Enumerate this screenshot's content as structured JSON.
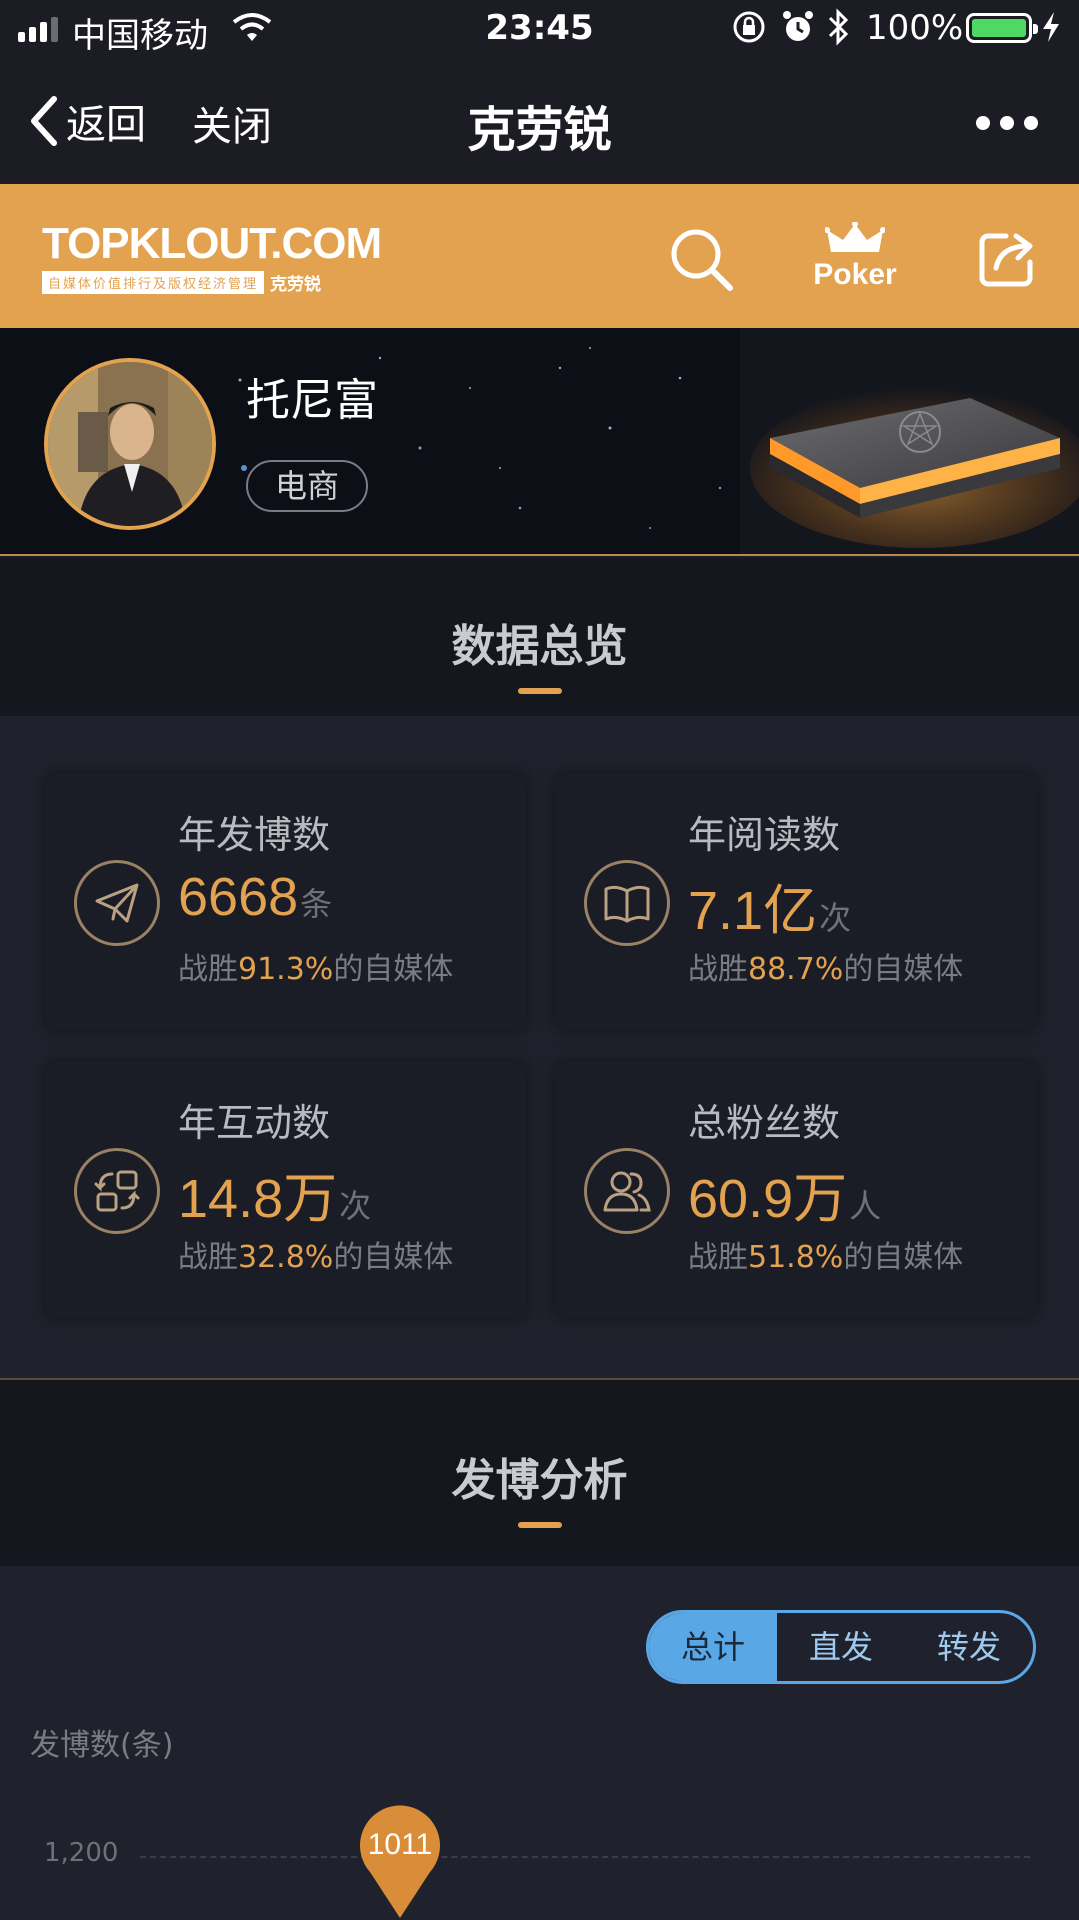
{
  "status_bar": {
    "carrier": "中国移动",
    "time": "23:45",
    "battery": "100%"
  },
  "nav": {
    "back_label": "返回",
    "close_label": "关闭",
    "title": "克劳锐"
  },
  "brand": {
    "logo": "TOPKLOUT.COM",
    "logo_tagline": "自媒体价值排行及版权经济管理",
    "logo_name": "克劳锐",
    "poker_label": "Poker"
  },
  "profile": {
    "name": "托尼富",
    "tag": "电商"
  },
  "overview": {
    "title": "数据总览",
    "cards": [
      {
        "label": "年发博数",
        "value": "6668",
        "unit": "条",
        "prefix": "战胜",
        "pct": "91.3%",
        "suffix": "的自媒体",
        "icon": "send-icon"
      },
      {
        "label": "年阅读数",
        "value": "7.1亿",
        "unit": "次",
        "prefix": "战胜",
        "pct": "88.7%",
        "suffix": "的自媒体",
        "icon": "book-icon"
      },
      {
        "label": "年互动数",
        "value": "14.8万",
        "unit": "次",
        "prefix": "战胜",
        "pct": "32.8%",
        "suffix": "的自媒体",
        "icon": "interaction-icon"
      },
      {
        "label": "总粉丝数",
        "value": "60.9万",
        "unit": "人",
        "prefix": "战胜",
        "pct": "51.8%",
        "suffix": "的自媒体",
        "icon": "fans-icon"
      }
    ]
  },
  "analysis": {
    "title": "发博分析",
    "segments": [
      "总计",
      "直发",
      "转发"
    ],
    "active_segment": "总计",
    "y_axis_label": "发博数(条)",
    "y_tick": "1,200",
    "marker_value": "1011"
  },
  "colors": {
    "accent": "#e3a250",
    "segment_blue": "#5aa7e6",
    "background": "#1f222c"
  }
}
